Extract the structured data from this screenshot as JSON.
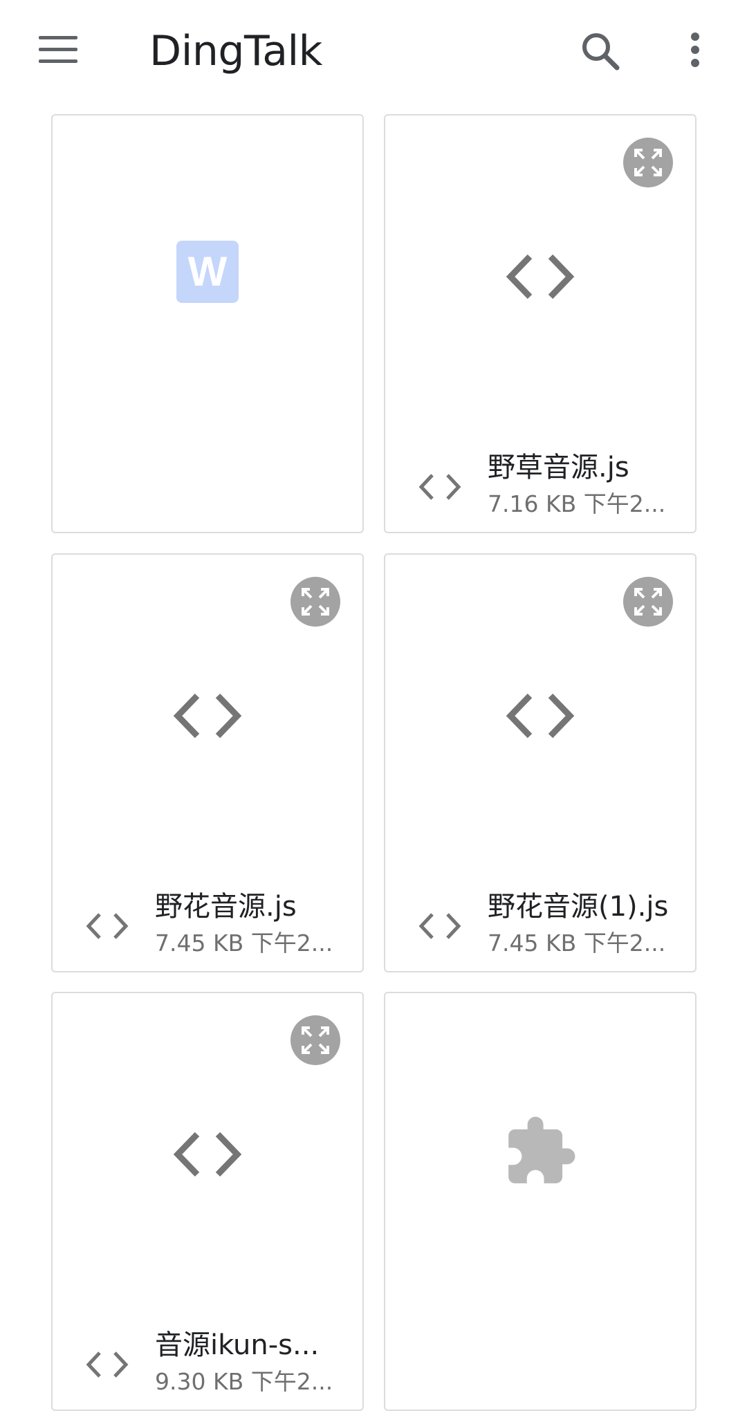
{
  "app_bar": {
    "title": "DingTalk",
    "menu_icon": "menu-icon",
    "search_icon": "search-icon",
    "more_icon": "more-vert-icon"
  },
  "colors": {
    "card_border": "#dcdcdc",
    "icon_gray": "#757575",
    "expand_circle": "#a3a3a3",
    "word_tile": "#c5d6fb",
    "puzzle": "#b8b8b8"
  },
  "files": [
    {
      "type": "word",
      "preview_icon": "word-doc-icon",
      "expandable": false,
      "name": "",
      "meta": ""
    },
    {
      "type": "code",
      "preview_icon": "code-icon",
      "expandable": true,
      "name": "野草音源.js",
      "meta": "7.16 KB 下午2..."
    },
    {
      "type": "code",
      "preview_icon": "code-icon",
      "expandable": true,
      "name": "野花音源.js",
      "meta": "7.45 KB 下午2..."
    },
    {
      "type": "code",
      "preview_icon": "code-icon",
      "expandable": true,
      "name": "野花音源(1).js",
      "meta": "7.45 KB 下午2..."
    },
    {
      "type": "code",
      "preview_icon": "code-icon",
      "expandable": true,
      "name": "音源ikun-s...",
      "meta": "9.30 KB 下午2..."
    },
    {
      "type": "extension",
      "preview_icon": "puzzle-icon",
      "expandable": false,
      "name": "",
      "meta": ""
    }
  ]
}
